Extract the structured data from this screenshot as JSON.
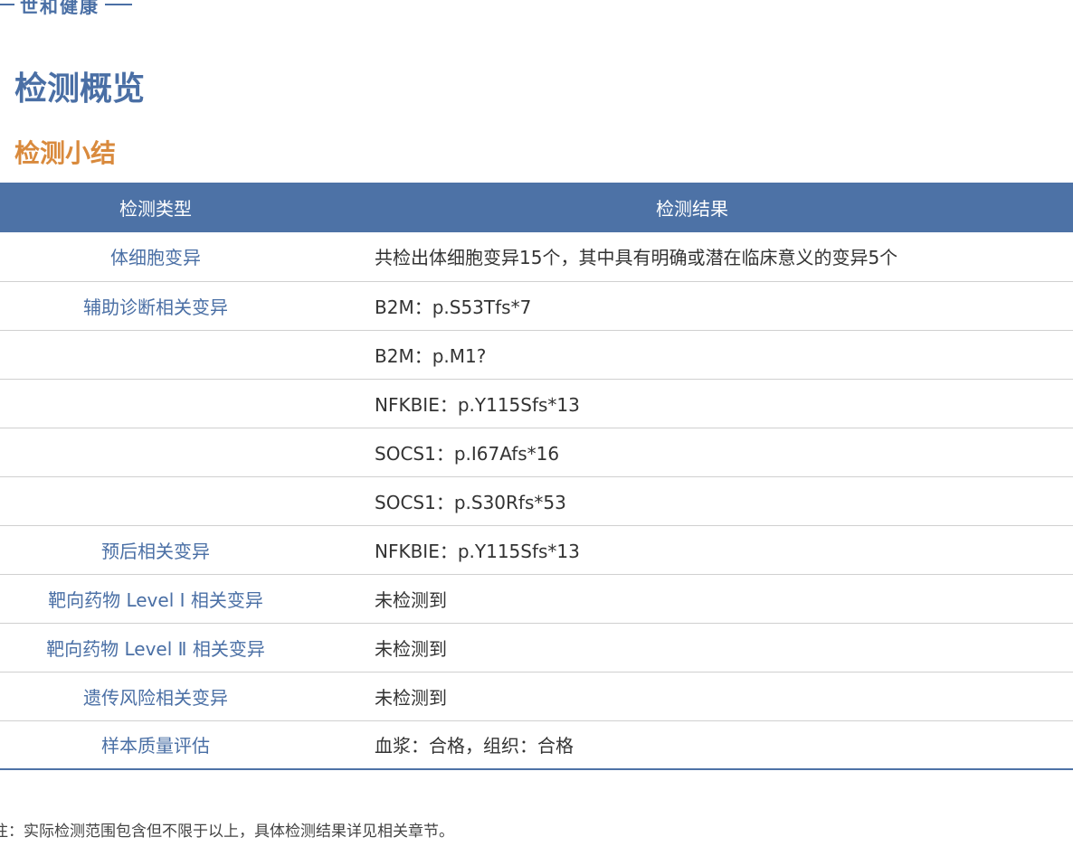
{
  "brand": {
    "name": "世和健康"
  },
  "page_title": "检测概览",
  "section_title": "检测小结",
  "table": {
    "headers": [
      "检测类型",
      "检测结果"
    ],
    "rows": [
      {
        "type": "体细胞变异",
        "result": "共检出体细胞变异15个，其中具有明确或潜在临床意义的变异5个"
      },
      {
        "type": "辅助诊断相关变异",
        "result": "B2M：p.S53Tfs*7"
      },
      {
        "type": "",
        "result": "B2M：p.M1?"
      },
      {
        "type": "",
        "result": "NFKBIE：p.Y115Sfs*13"
      },
      {
        "type": "",
        "result": "SOCS1：p.I67Afs*16"
      },
      {
        "type": "",
        "result": "SOCS1：p.S30Rfs*53"
      },
      {
        "type": "预后相关变异",
        "result": "NFKBIE：p.Y115Sfs*13"
      },
      {
        "type": "靶向药物 Level Ⅰ 相关变异",
        "result": "未检测到"
      },
      {
        "type": "靶向药物 Level Ⅱ 相关变异",
        "result": "未检测到"
      },
      {
        "type": "遗传风险相关变异",
        "result": "未检测到"
      },
      {
        "type": "样本质量评估",
        "result": "血浆：合格，组织：合格"
      }
    ]
  },
  "footnote": "注：实际检测范围包含但不限于以上，具体检测结果详见相关章节。",
  "colors": {
    "primary": "#4d72a6",
    "accent": "#d98a3d"
  }
}
